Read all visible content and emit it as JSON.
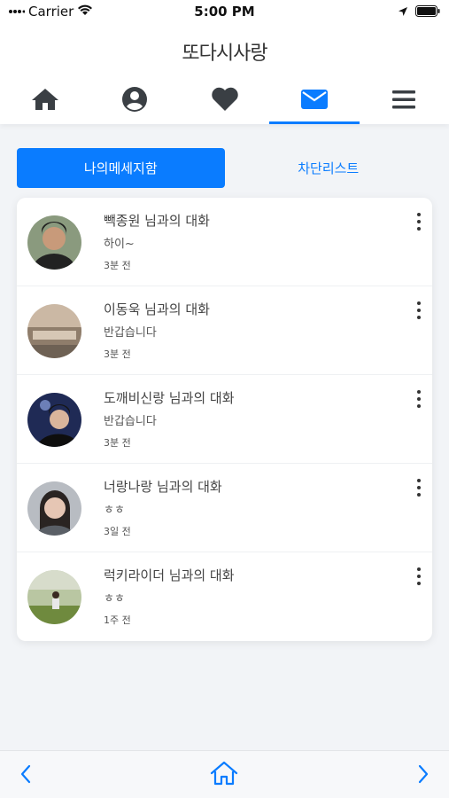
{
  "status_bar": {
    "carrier": "Carrier",
    "time": "5:00 PM"
  },
  "header": {
    "logo": "또다시사랑"
  },
  "nav": {
    "items": [
      {
        "icon": "home-icon",
        "active": false
      },
      {
        "icon": "profile-icon",
        "active": false
      },
      {
        "icon": "heart-icon",
        "active": false
      },
      {
        "icon": "mail-icon",
        "active": true
      },
      {
        "icon": "menu-icon",
        "active": false
      }
    ]
  },
  "tabs": {
    "my_messages": "나의메세지함",
    "block_list": "차단리스트"
  },
  "conversations": [
    {
      "title": "빽종원 님과의 대화",
      "message": "하이~",
      "time": "3분 전"
    },
    {
      "title": "이동욱 님과의 대화",
      "message": "반갑습니다",
      "time": "3분 전"
    },
    {
      "title": "도깨비신랑 님과의 대화",
      "message": "반갑습니다",
      "time": "3분 전"
    },
    {
      "title": "너랑나랑 님과의 대화",
      "message": "ㅎㅎ",
      "time": "3일 전"
    },
    {
      "title": "럭키라이더 님과의 대화",
      "message": "ㅎㅎ",
      "time": "1주 전"
    }
  ],
  "colors": {
    "accent": "#0a7cff",
    "icon_dark": "#3a3f44"
  }
}
